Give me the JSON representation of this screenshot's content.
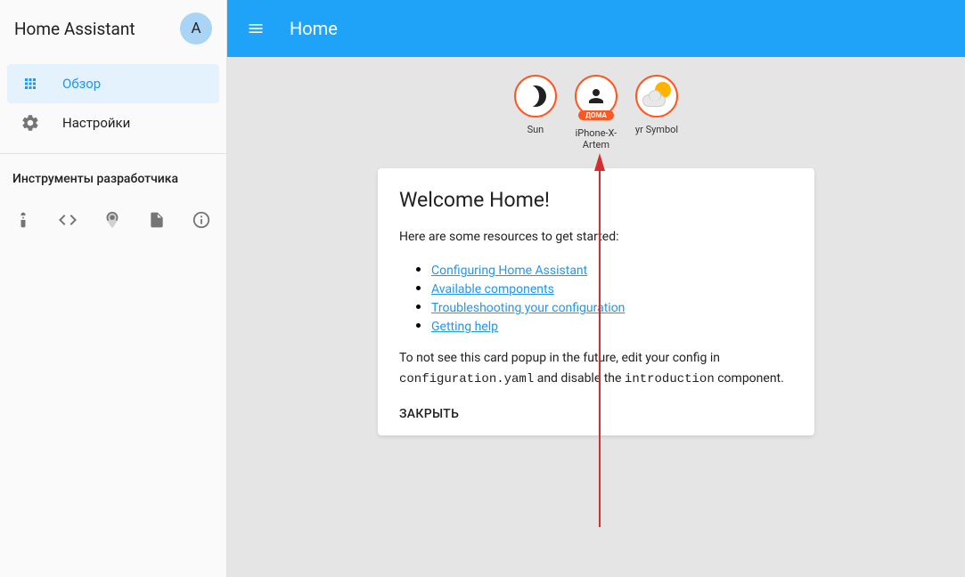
{
  "app": {
    "title": "Home Assistant",
    "avatar_letter": "A"
  },
  "sidebar": {
    "items": [
      {
        "label": "Обзор",
        "active": true
      },
      {
        "label": "Настройки",
        "active": false
      }
    ],
    "section_title": "Инструменты разработчика"
  },
  "topbar": {
    "title": "Home"
  },
  "badges": [
    {
      "label": "Sun",
      "sublabel": null
    },
    {
      "label": "iPhone-X-Artem",
      "sublabel": "ДОМА"
    },
    {
      "label": "yr Symbol",
      "sublabel": null
    }
  ],
  "welcome_card": {
    "title": "Welcome Home!",
    "intro": "Here are some resources to get started:",
    "links": [
      "Configuring Home Assistant",
      "Available components",
      "Troubleshooting your configuration",
      "Getting help"
    ],
    "footer_pre": "To not see this card popup in the future, edit your config in ",
    "footer_code1": "configuration.yaml",
    "footer_mid": " and disable the ",
    "footer_code2": "introduction",
    "footer_post": " component.",
    "action": "ЗАКРЫТЬ"
  }
}
